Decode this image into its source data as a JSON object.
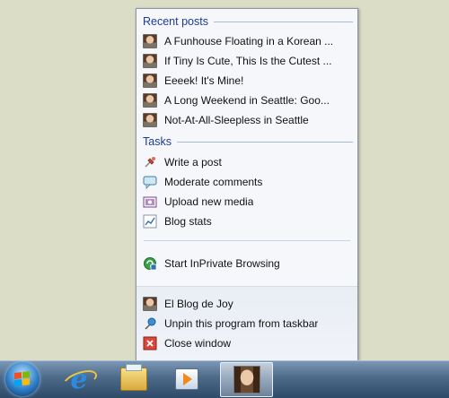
{
  "jumplist": {
    "recent_header": "Recent posts",
    "recent_posts": [
      {
        "label": "A Funhouse Floating in a Korean ...",
        "icon": "avatar-icon"
      },
      {
        "label": "If Tiny Is Cute, This Is the Cutest ...",
        "icon": "avatar-icon"
      },
      {
        "label": "Eeeek! It's Mine!",
        "icon": "avatar-icon"
      },
      {
        "label": "A Long Weekend in Seattle: Goo...",
        "icon": "avatar-icon"
      },
      {
        "label": "Not-At-All-Sleepless in Seattle",
        "icon": "avatar-icon"
      }
    ],
    "tasks_header": "Tasks",
    "tasks": [
      {
        "label": "Write a post",
        "icon": "pushpin-pen-icon"
      },
      {
        "label": "Moderate comments",
        "icon": "comment-bubble-icon"
      },
      {
        "label": "Upload new media",
        "icon": "media-upload-icon"
      },
      {
        "label": "Blog stats",
        "icon": "chart-icon"
      }
    ],
    "inprivate_label": "Start InPrivate Browsing",
    "bottom_items": [
      {
        "label": "El Blog de Joy",
        "icon": "avatar-icon"
      },
      {
        "label": "Unpin this program from taskbar",
        "icon": "unpin-icon"
      },
      {
        "label": "Close window",
        "icon": "close-window-icon"
      }
    ]
  },
  "taskbar": {
    "items": [
      "start-orb",
      "internet-explorer-icon",
      "windows-explorer-icon",
      "media-player-icon",
      "blog-site-pinned-icon"
    ],
    "accent_color": "#4c6988"
  },
  "colors": {
    "header_text": "#1b3b9a",
    "desktop_bg": "#dcddc6"
  }
}
